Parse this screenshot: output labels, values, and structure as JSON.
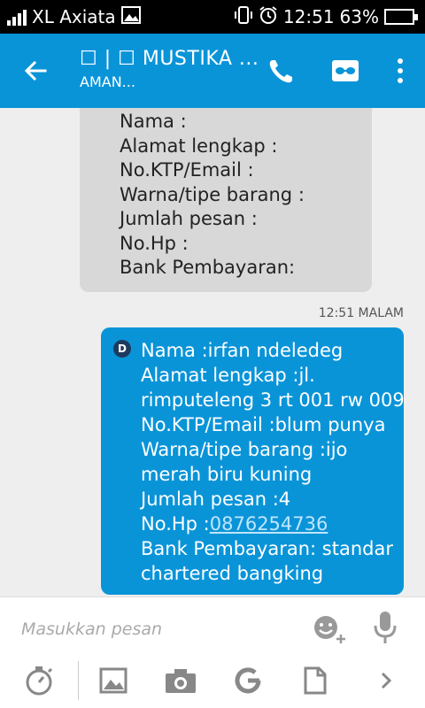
{
  "status_bar": {
    "carrier": "XL Axiata",
    "time": "12:51",
    "battery": "63%"
  },
  "header": {
    "title": "☐ | ☐ MUSTIKA ...",
    "subtitle": "AMAN..."
  },
  "incoming_message": {
    "lines": [
      "Nama :",
      "Alamat lengkap :",
      "No.KTP/Email :",
      "Warna/tipe barang :",
      "Jumlah pesan :",
      "No.Hp :",
      "Bank Pembayaran:"
    ]
  },
  "message_time": "12:51 MALAM",
  "outgoing_message": {
    "sim_label": "D",
    "lines": [
      "Nama :irfan ndeledeg",
      "Alamat lengkap :jl.",
      "rimputeleng 3 rt 001 rw 009",
      "No.KTP/Email :blum punya",
      "Warna/tipe barang :ijo",
      "merah biru kuning",
      "Jumlah pesan :4"
    ],
    "phone_prefix": "No.Hp :",
    "phone_number": "0876254736",
    "lines_after": [
      "Bank Pembayaran: standar",
      "chartered bangking"
    ]
  },
  "composer": {
    "placeholder": "Masukkan pesan",
    "value": ""
  },
  "colors": {
    "accent": "#0a94d8",
    "incoming_bubble": "#d8d8d8"
  },
  "icons": {
    "back": "arrow-left-icon",
    "call": "phone-icon",
    "contact": "contact-card-icon",
    "more": "more-vert-icon",
    "emoji": "emoji-add-icon",
    "mic": "microphone-icon",
    "timer": "timer-icon",
    "image": "image-icon",
    "camera": "camera-icon",
    "gif": "google-icon",
    "file": "file-icon",
    "expand": "chevron-right-icon"
  }
}
